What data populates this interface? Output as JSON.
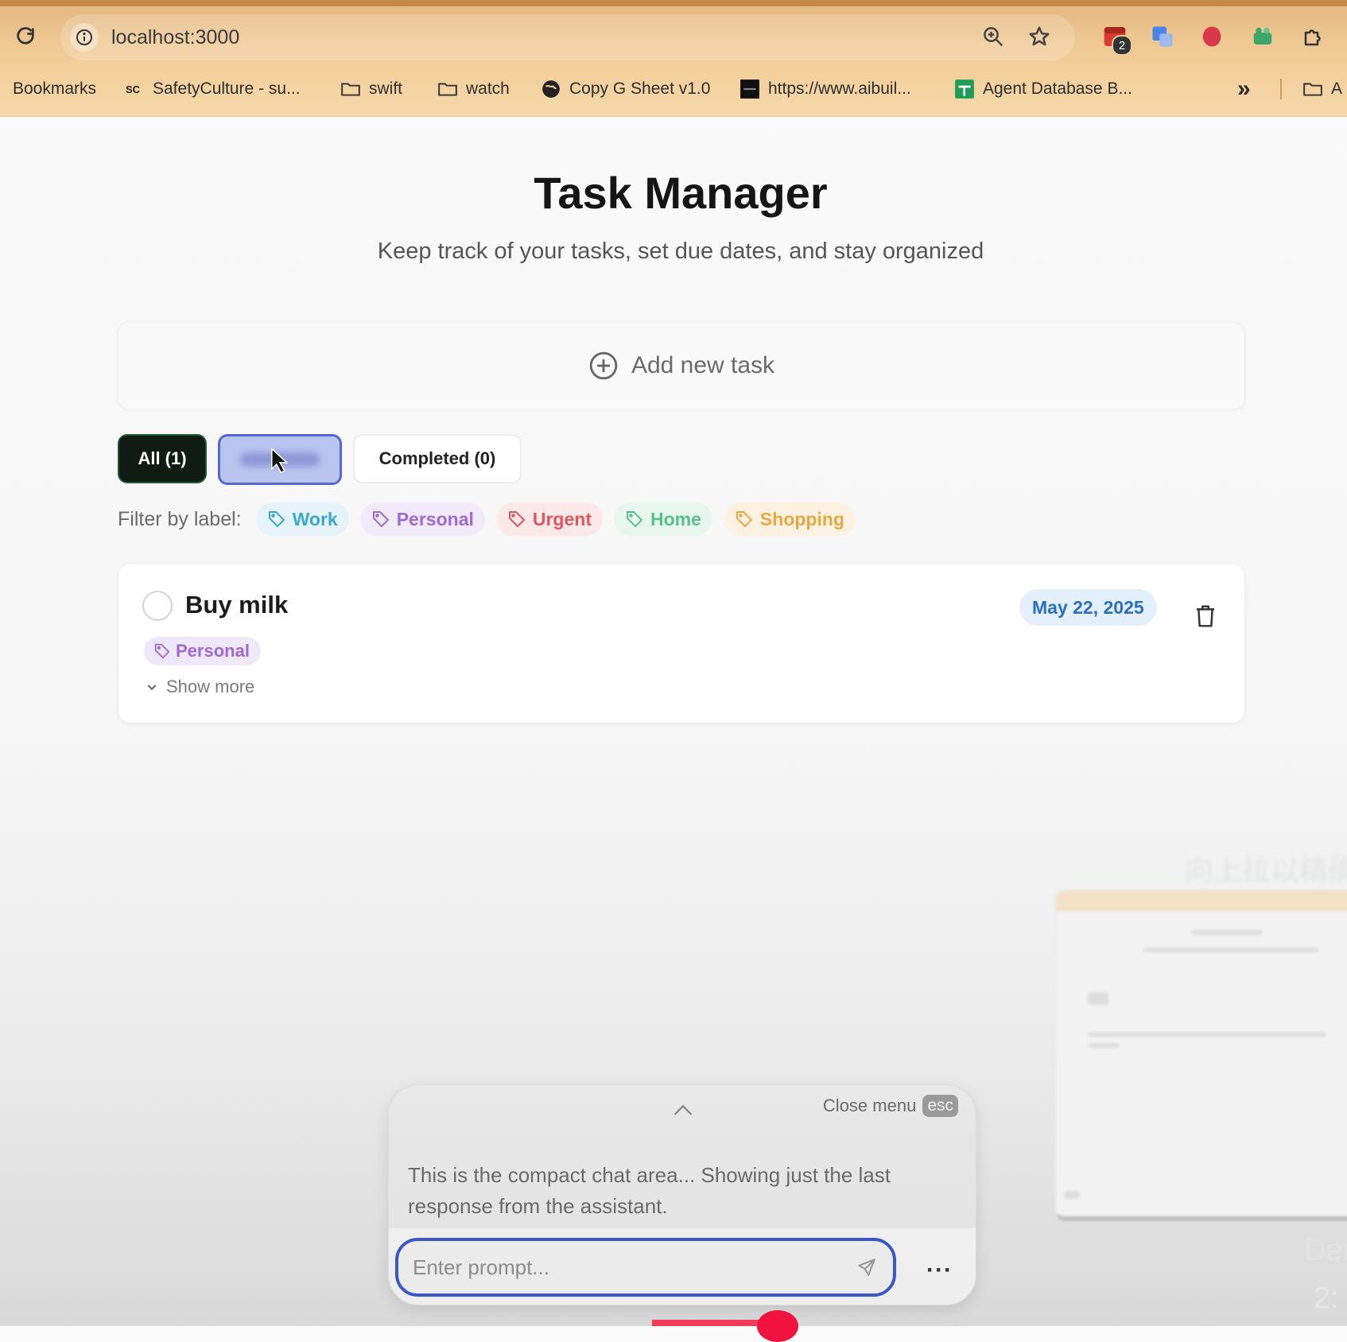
{
  "browser": {
    "url": "localhost:3000",
    "extension_badge": "2",
    "bookmarks": [
      {
        "label": "Bookmarks",
        "icon": "none"
      },
      {
        "label": "SafetyCulture - su...",
        "icon": "sc-logo-icon"
      },
      {
        "label": "swift",
        "icon": "folder-icon"
      },
      {
        "label": "watch",
        "icon": "folder-icon"
      },
      {
        "label": "Copy G Sheet v1.0",
        "icon": "globe-icon"
      },
      {
        "label": "https://www.aibuil...",
        "icon": "site-logo-icon"
      },
      {
        "label": "Agent Database B...",
        "icon": "sheets-icon"
      },
      {
        "label": "A",
        "icon": "folder-icon"
      }
    ],
    "overflow_label": "»"
  },
  "header": {
    "title": "Task Manager",
    "subtitle": "Keep track of your tasks, set due dates, and stay organized"
  },
  "add_task": {
    "label": "Add new task"
  },
  "tabs": [
    {
      "label": "All (1)",
      "state": "selected"
    },
    {
      "label": "",
      "state": "hover-blurred"
    },
    {
      "label": "Completed (0)",
      "state": "default"
    }
  ],
  "filters": {
    "label": "Filter by label:",
    "chips": [
      {
        "label": "Work",
        "fg": "#3aa7cf",
        "bg": "#e6f4fa"
      },
      {
        "label": "Personal",
        "fg": "#9d6ad6",
        "bg": "#f1eafa"
      },
      {
        "label": "Urgent",
        "fg": "#e0575d",
        "bg": "#fbe8e8"
      },
      {
        "label": "Home",
        "fg": "#58c08a",
        "bg": "#e8f7ee"
      },
      {
        "label": "Shopping",
        "fg": "#e8a842",
        "bg": "#fdf2e1"
      }
    ]
  },
  "tasks": [
    {
      "title": "Buy milk",
      "label": "Personal",
      "label_fg": "#9d6ad6",
      "label_bg": "#efe7fa",
      "due": "May 22, 2025",
      "due_fg": "#2b6fc2",
      "due_bg": "#e3effb",
      "show_more": "Show more",
      "completed": false
    }
  ],
  "chat": {
    "close_label": "Close menu",
    "close_key": "esc",
    "message": "This is the compact chat area... Showing just the last response from the assistant.",
    "prompt_placeholder": "Enter prompt...",
    "more_label": "···"
  },
  "overlay": {
    "pip_caption": "向上拉以精确",
    "corner_top": "Der",
    "corner_bottom": "2:"
  },
  "colors": {
    "accent": "#3d56c7",
    "tab_all_bg": "#0f1b13",
    "chrome": "#f1cb96"
  }
}
